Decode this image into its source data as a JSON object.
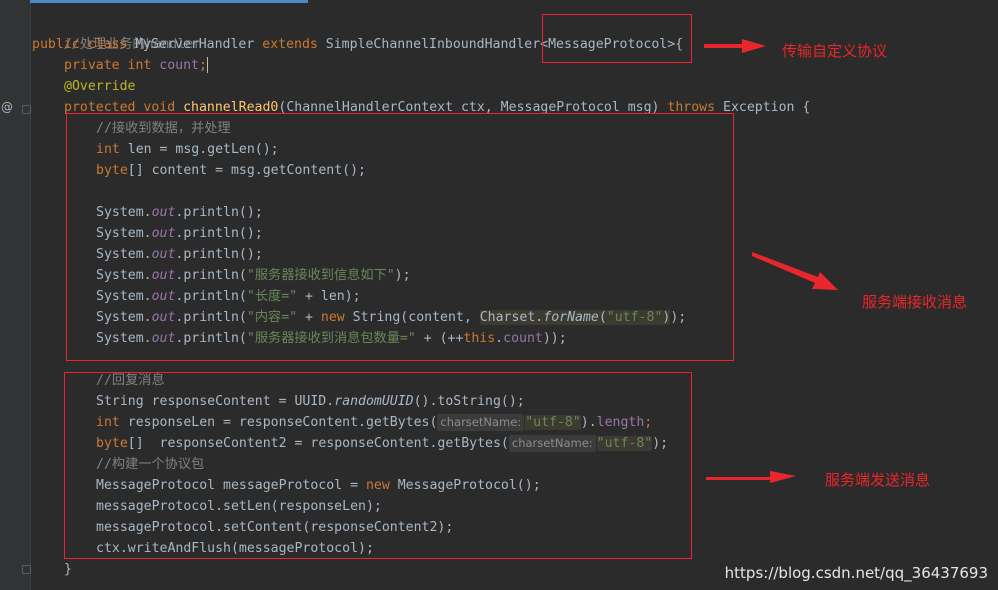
{
  "code": {
    "l1": "//处理业务的handler",
    "l2": {
      "kw1": "public class ",
      "name": "MyServerHandler ",
      "kw2": "extends ",
      "rest": "SimpleChannelInboundHandler<MessageProtocol>{"
    },
    "l3": {
      "kw": "private int ",
      "field": "count",
      "end": ";"
    },
    "l4": "@Override",
    "l5": {
      "kw": "protected void ",
      "fn": "channelRead0",
      "params": "(ChannelHandlerContext ctx, MessageProtocol msg) ",
      "throws": "throws ",
      "exc": "Exception {"
    },
    "l6": "//接收到数据，并处理",
    "l7": {
      "kw": "int ",
      "rest": "len = msg.getLen();"
    },
    "l8": {
      "kw": "byte",
      "rest": "[] content = msg.getContent();"
    },
    "sys": "System.",
    "out": "out",
    "println": ".println(",
    "close": ");",
    "l9": ");",
    "l12": "\"服务器接收到信息如下\"",
    "l13": {
      "str": "\"长度=\"",
      "rest": " + len);"
    },
    "l14": {
      "str": "\"内容=\"",
      "plus": " + ",
      "new": "new ",
      "mid": "String(content, ",
      "cs": "Charset.",
      "forName": "forName",
      "open": "(",
      "utf": "\"utf-8\"",
      "end": "));"
    },
    "l15": {
      "str": "\"服务器接收到消息包数量=\"",
      "mid": " + (++",
      "this": "this",
      "dot": ".",
      "count": "count",
      "end": "));"
    },
    "l16": "//回复消息",
    "l17": {
      "a": "String responseContent = UUID.",
      "b": "randomUUID",
      "c": "().toString();"
    },
    "l18": {
      "kw": "int ",
      "a": "responseLen = responseContent.getBytes(",
      "hint": "charsetName:",
      "utf": "\"utf-8\"",
      "b": ").",
      "len": "length",
      "c": ";"
    },
    "l19": {
      "kw": "byte",
      "a": "[]  responseContent2 = responseContent.getBytes(",
      "hint": "charsetName:",
      "utf": "\"utf-8\"",
      "c": ");"
    },
    "l20": "//构建一个协议包",
    "l21": {
      "a": "MessageProtocol messageProtocol = ",
      "new": "new ",
      "b": "MessageProtocol();"
    },
    "l22": "messageProtocol.setLen(responseLen);",
    "l23": "messageProtocol.setContent(responseContent2);",
    "l24": "ctx.writeAndFlush(messageProtocol);",
    "l25": "}"
  },
  "annotations": {
    "note1": "传输自定义协议",
    "note2": "服务端接收消息",
    "note3": "服务端发送消息",
    "color": "#e8262b"
  },
  "watermark": "https://blog.csdn.net/qq_36437693",
  "gutter": {
    "override_icon": "@"
  },
  "colors": {
    "background": "#2b2b2b",
    "keyword": "#cc7832",
    "string": "#6a8759",
    "comment": "#808080",
    "field": "#9876aa",
    "function": "#ffc66d",
    "annotation": "#bbb529"
  }
}
